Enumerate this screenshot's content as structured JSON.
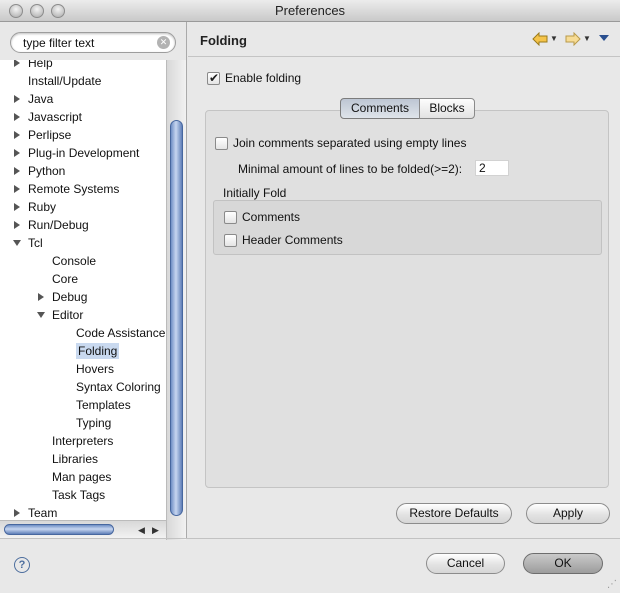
{
  "window": {
    "title": "Preferences"
  },
  "filter": {
    "value": "type filter text"
  },
  "tree": [
    {
      "label": "Help",
      "level": 0,
      "expander": "right"
    },
    {
      "label": "Install/Update",
      "level": 0,
      "expander": "none"
    },
    {
      "label": "Java",
      "level": 0,
      "expander": "right"
    },
    {
      "label": "Javascript",
      "level": 0,
      "expander": "right"
    },
    {
      "label": "Perlipse",
      "level": 0,
      "expander": "right"
    },
    {
      "label": "Plug-in Development",
      "level": 0,
      "expander": "right"
    },
    {
      "label": "Python",
      "level": 0,
      "expander": "right"
    },
    {
      "label": "Remote Systems",
      "level": 0,
      "expander": "right"
    },
    {
      "label": "Ruby",
      "level": 0,
      "expander": "right"
    },
    {
      "label": "Run/Debug",
      "level": 0,
      "expander": "right"
    },
    {
      "label": "Tcl",
      "level": 0,
      "expander": "down"
    },
    {
      "label": "Console",
      "level": 1,
      "expander": "none"
    },
    {
      "label": "Core",
      "level": 1,
      "expander": "none"
    },
    {
      "label": "Debug",
      "level": 1,
      "expander": "right"
    },
    {
      "label": "Editor",
      "level": 1,
      "expander": "down"
    },
    {
      "label": "Code Assistance",
      "level": 2,
      "expander": "none"
    },
    {
      "label": "Folding",
      "level": 2,
      "expander": "none",
      "selected": true
    },
    {
      "label": "Hovers",
      "level": 2,
      "expander": "none"
    },
    {
      "label": "Syntax Coloring",
      "level": 2,
      "expander": "none"
    },
    {
      "label": "Templates",
      "level": 2,
      "expander": "none"
    },
    {
      "label": "Typing",
      "level": 2,
      "expander": "none"
    },
    {
      "label": "Interpreters",
      "level": 1,
      "expander": "none"
    },
    {
      "label": "Libraries",
      "level": 1,
      "expander": "none"
    },
    {
      "label": "Man pages",
      "level": 1,
      "expander": "none"
    },
    {
      "label": "Task Tags",
      "level": 1,
      "expander": "none"
    },
    {
      "label": "Team",
      "level": 0,
      "expander": "right"
    }
  ],
  "page": {
    "title": "Folding",
    "enable_folding": {
      "label": "Enable folding",
      "checked": true
    },
    "tabs": [
      {
        "label": "Comments",
        "active": true
      },
      {
        "label": "Blocks",
        "active": false
      }
    ],
    "join_comments": {
      "label": "Join comments separated using empty lines",
      "checked": false
    },
    "min_lines": {
      "label": "Minimal amount of lines to be folded(>=2):",
      "value": "2"
    },
    "initially_fold": {
      "label": "Initially Fold",
      "comments": {
        "label": "Comments",
        "checked": false
      },
      "header_comments": {
        "label": "Header Comments",
        "checked": false
      }
    },
    "restore_defaults_label": "Restore Defaults",
    "apply_label": "Apply"
  },
  "dialog": {
    "cancel_label": "Cancel",
    "ok_label": "OK"
  }
}
